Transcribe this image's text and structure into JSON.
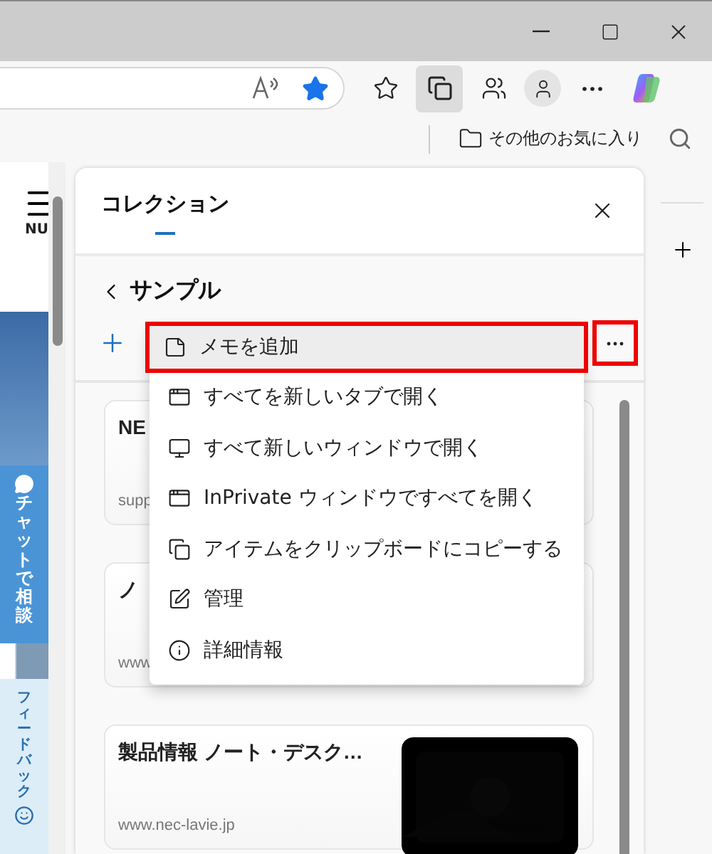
{
  "toolbar": {
    "collections_button": {
      "selected": true
    }
  },
  "favorites_bar": {
    "other_favorites": "その他のお気に入り"
  },
  "web_page": {
    "menu_label": "NU",
    "chat_label": "チャットで相談",
    "feedback_label": "フィードバック"
  },
  "collections_panel": {
    "title": "コレクション",
    "collection_name": "サンプル",
    "more_button": {
      "highlighted": true
    },
    "menu": [
      {
        "label": "メモを追加",
        "kind": "memo",
        "highlighted": true
      },
      {
        "label": "すべてを新しいタブで開く",
        "kind": "tab",
        "highlighted": false
      },
      {
        "label": "すべて新しいウィンドウで開く",
        "kind": "window",
        "highlighted": false
      },
      {
        "label": "InPrivate ウィンドウですべてを開く",
        "kind": "private",
        "highlighted": false
      },
      {
        "label": "アイテムをクリップボードにコピーする",
        "kind": "copy",
        "highlighted": false
      },
      {
        "label": "管理",
        "kind": "manage",
        "highlighted": false
      },
      {
        "label": "詳細情報",
        "kind": "info",
        "highlighted": false
      }
    ],
    "items": [
      {
        "title": "NE",
        "url": "supp"
      },
      {
        "title": "ノ",
        "url": "www"
      },
      {
        "title": "製品情報 ノート・デスク…",
        "url": "www.nec-lavie.jp",
        "kind": "picture"
      }
    ]
  }
}
